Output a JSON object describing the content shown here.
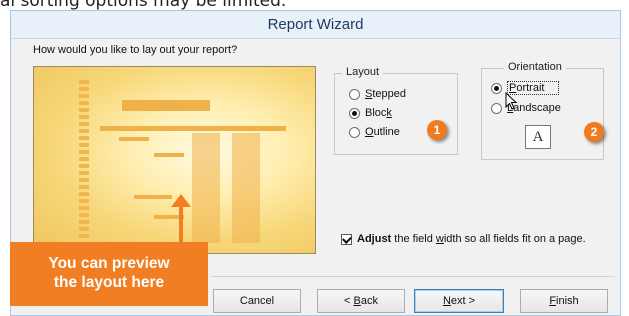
{
  "page_caption": "al sorting options may be limited.",
  "dialog": {
    "title": "Report Wizard",
    "question": "How would you like to lay out your report?"
  },
  "layout": {
    "legend": "Layout",
    "options": [
      {
        "pre": "",
        "key": "S",
        "post": "tepped",
        "selected": false
      },
      {
        "pre": "Bloc",
        "key": "k",
        "post": "",
        "selected": true
      },
      {
        "pre": "",
        "key": "O",
        "post": "utline",
        "selected": false
      }
    ]
  },
  "orientation": {
    "legend": "Orientation",
    "options": [
      {
        "pre": "",
        "key": "P",
        "post": "ortrait",
        "selected": true
      },
      {
        "pre": "",
        "key": "L",
        "post": "andscape",
        "selected": false
      }
    ],
    "page_icon_letter": "A"
  },
  "badges": [
    "1",
    "2"
  ],
  "adjust_checkbox": {
    "checked": true,
    "pre": "Adjust",
    "mid1": " the field ",
    "key": "w",
    "mid2": "idth so all fields fit on a page."
  },
  "buttons": {
    "cancel": "Cancel",
    "back": {
      "pre": "< ",
      "key": "B",
      "post": "ack"
    },
    "next": {
      "key": "N",
      "post": "ext >"
    },
    "finish": {
      "key": "F",
      "post": "inish"
    }
  },
  "callout": {
    "line1": "You can preview",
    "line2": "the layout here"
  },
  "colors": {
    "callout": "#f17e22",
    "preview_bg": "#f4d97a"
  }
}
